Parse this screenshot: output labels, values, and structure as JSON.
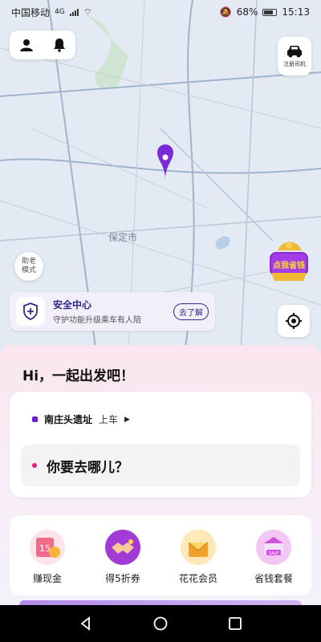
{
  "status_bar": {
    "carrier": "中国移动",
    "network": "4G",
    "battery": "68%",
    "time": "15:13"
  },
  "map": {
    "city_label": "保定市"
  },
  "top_actions": {
    "profile_icon": "user-icon",
    "notification_icon": "bell-icon"
  },
  "driver": {
    "label": "注册司机"
  },
  "elder_mode": {
    "label_line1": "助老",
    "label_line2": "模式"
  },
  "promo": {
    "text": "点我省钱"
  },
  "safety": {
    "title": "安全中心",
    "subtitle": "守护功能升级乘车有人陪",
    "action": "去了解"
  },
  "sheet": {
    "greeting": "Hi，一起出发吧！",
    "pickup_place": "南庄头遗址",
    "pickup_suffix": "上车",
    "destination_prompt": "你要去哪儿？"
  },
  "services": [
    {
      "label": "赚现金",
      "color": "#f06b8a"
    },
    {
      "label": "得5折券",
      "color": "#a23ad6"
    },
    {
      "label": "花花会员",
      "color": "#f0a12a"
    },
    {
      "label": "省钱套餐",
      "color": "#d24fe0"
    }
  ],
  "colors": {
    "brand_purple": "#6a1fd0",
    "pin_purple": "#7b2bd6",
    "destination_dot": "#e0207a"
  }
}
